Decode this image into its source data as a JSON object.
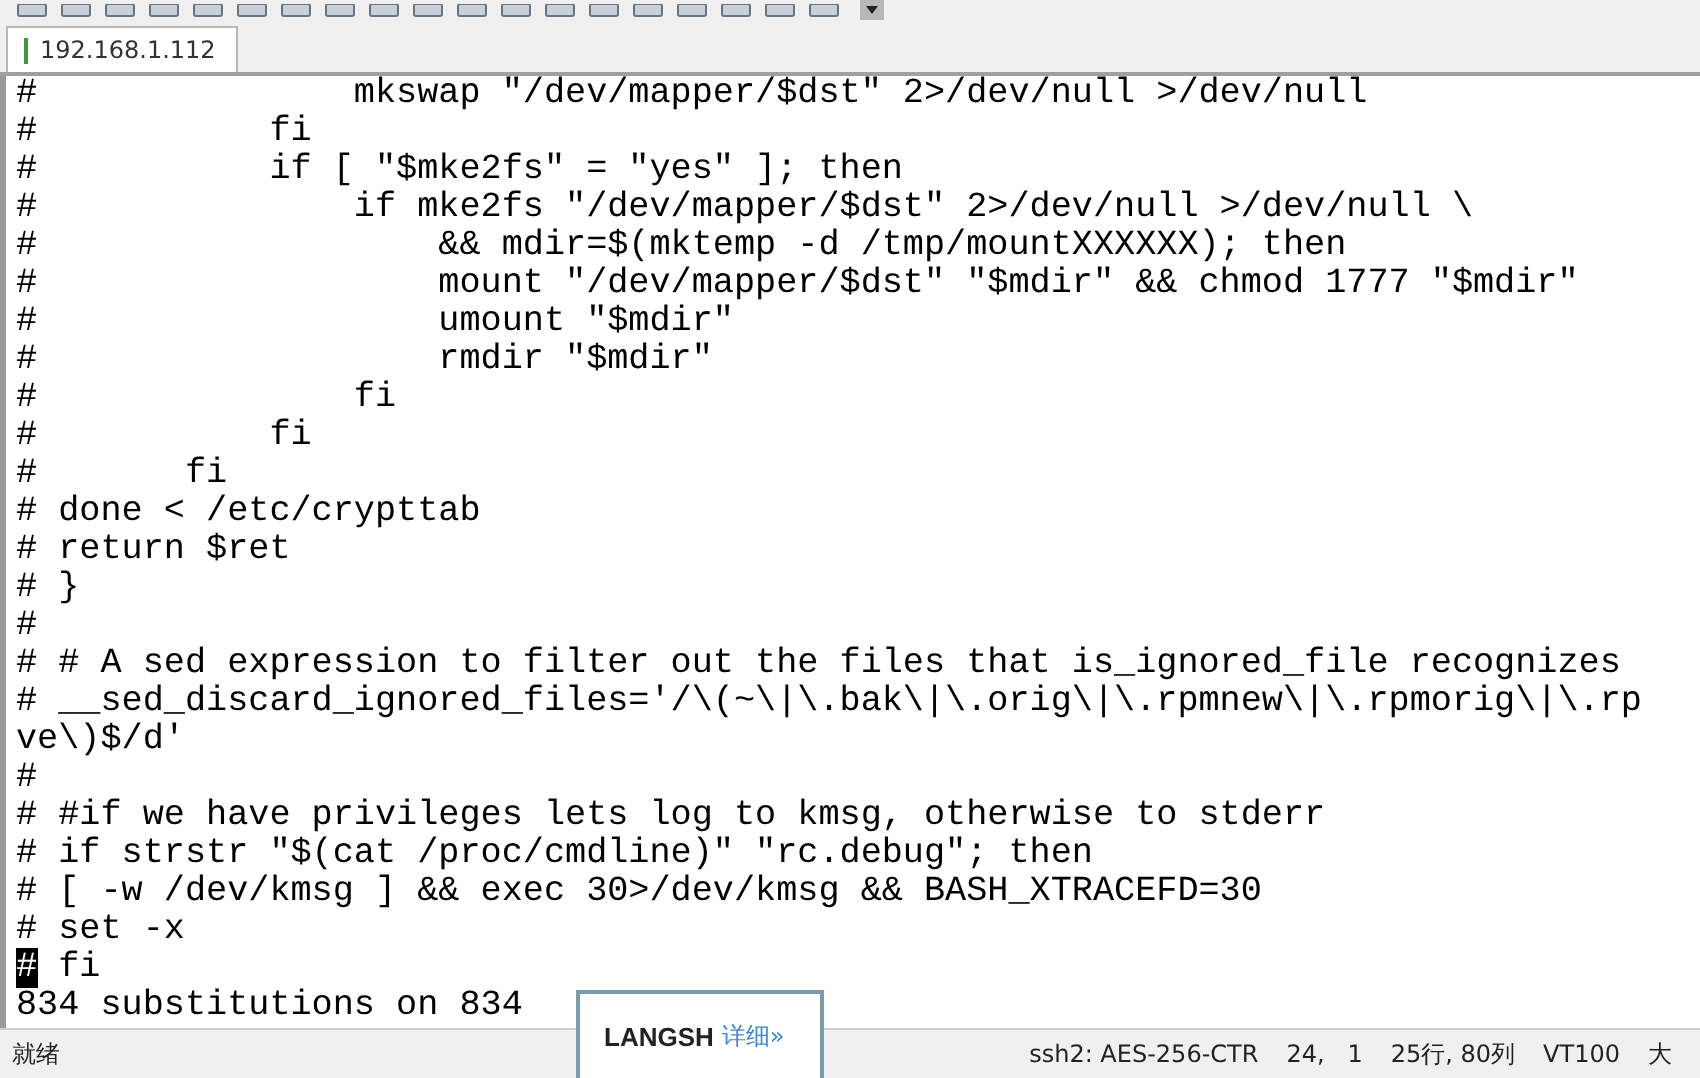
{
  "tab": {
    "label": "192.168.1.112",
    "selected": true
  },
  "terminal": {
    "lines": [
      {
        "text": "#               mkswap \"/dev/mapper/$dst\" 2>/dev/null >/dev/null",
        "cursor": false
      },
      {
        "text": "#           fi",
        "cursor": false
      },
      {
        "text": "#           if [ \"$mke2fs\" = \"yes\" ]; then",
        "cursor": false
      },
      {
        "text": "#               if mke2fs \"/dev/mapper/$dst\" 2>/dev/null >/dev/null \\",
        "cursor": false
      },
      {
        "text": "#                   && mdir=$(mktemp -d /tmp/mountXXXXXX); then",
        "cursor": false
      },
      {
        "text": "#                   mount \"/dev/mapper/$dst\" \"$mdir\" && chmod 1777 \"$mdir\"",
        "cursor": false
      },
      {
        "text": "#                   umount \"$mdir\"",
        "cursor": false
      },
      {
        "text": "#                   rmdir \"$mdir\"",
        "cursor": false
      },
      {
        "text": "#               fi",
        "cursor": false
      },
      {
        "text": "#           fi",
        "cursor": false
      },
      {
        "text": "#       fi",
        "cursor": false
      },
      {
        "text": "# done < /etc/crypttab",
        "cursor": false
      },
      {
        "text": "# return $ret",
        "cursor": false
      },
      {
        "text": "# }",
        "cursor": false
      },
      {
        "text": "#",
        "cursor": false
      },
      {
        "text": "# # A sed expression to filter out the files that is_ignored_file recognizes",
        "cursor": false
      },
      {
        "text": "# __sed_discard_ignored_files='/\\(~\\|\\.bak\\|\\.orig\\|\\.rpmnew\\|\\.rpmorig\\|\\.rp",
        "cursor": false
      },
      {
        "text": "ve\\)$/d'",
        "cursor": false
      },
      {
        "text": "#",
        "cursor": false
      },
      {
        "text": "# #if we have privileges lets log to kmsg, otherwise to stderr",
        "cursor": false
      },
      {
        "text": "# if strstr \"$(cat /proc/cmdline)\" \"rc.debug\"; then",
        "cursor": false
      },
      {
        "text": "# [ -w /dev/kmsg ] && exec 30>/dev/kmsg && BASH_XTRACEFD=30",
        "cursor": false
      },
      {
        "text": "# set -x",
        "cursor": false
      },
      {
        "text": "# fi",
        "cursor": true
      },
      {
        "text": "834 substitutions on 834",
        "cursor": false
      }
    ]
  },
  "popup": {
    "title": "LANGSH",
    "link": "详细»"
  },
  "status_bar": {
    "state": "就绪",
    "cipher": "ssh2: AES-256-CTR",
    "position": "24,   1",
    "size": "25行, 80列",
    "emulation": "VT100",
    "caps": "大"
  }
}
